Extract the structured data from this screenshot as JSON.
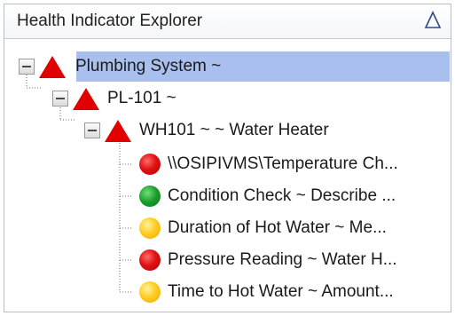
{
  "panel": {
    "title": "Health Indicator Explorer",
    "collapse_icon": "collapse-triangle-icon"
  },
  "tree": {
    "root": {
      "label": "Plumbing System ~",
      "status": "red-triangle",
      "expanded": true,
      "selected": true
    },
    "level1": {
      "label": "PL-101 ~",
      "status": "red-triangle",
      "expanded": true
    },
    "level2": {
      "label": "WH101 ~  ~ Water Heater",
      "status": "red-triangle",
      "expanded": true
    },
    "indicators": [
      {
        "label": "\\\\OSIPIVMS\\Temperature Ch...",
        "status": "red"
      },
      {
        "label": "Condition Check ~ Describe ...",
        "status": "green"
      },
      {
        "label": "Duration of Hot Water ~ Me...",
        "status": "yellow"
      },
      {
        "label": "Pressure Reading ~ Water H...",
        "status": "red"
      },
      {
        "label": "Time to Hot Water ~ Amount...",
        "status": "yellow"
      }
    ]
  },
  "colors": {
    "selection": "#a9c0ef",
    "alarm_red": "#e01212",
    "ok_green": "#199b2b",
    "warn_yellow": "#ffcd22"
  }
}
